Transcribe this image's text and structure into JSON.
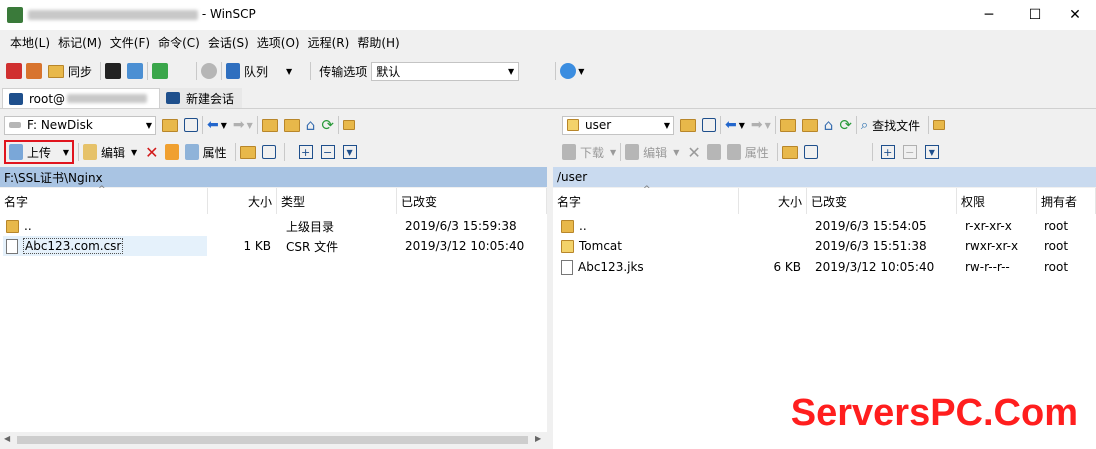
{
  "window": {
    "title_suffix": "- WinSCP",
    "minimize": "─",
    "maximize": "☐",
    "close": "✕"
  },
  "menu": [
    "本地(L)",
    "标记(M)",
    "文件(F)",
    "命令(C)",
    "会话(S)",
    "选项(O)",
    "远程(R)",
    "帮助(H)"
  ],
  "toolbar1": {
    "sync_label": "同步",
    "queue_label": "队列",
    "transfer_label": "传输选项",
    "transfer_value": "默认"
  },
  "tabs": {
    "session_label": "root@",
    "new_session_label": "新建会话"
  },
  "left": {
    "drive": "F: NewDisk",
    "upload_label": "上传",
    "edit_label": "编辑",
    "props_label": "属性",
    "path": "F:\\SSL证书\\Nginx",
    "columns": [
      "名字",
      "大小",
      "类型",
      "已改变"
    ],
    "rows": [
      {
        "name": "..",
        "size": "",
        "type": "上级目录",
        "changed": "2019/6/3  15:59:38"
      },
      {
        "name": "Abc123.com.csr",
        "size": "1 KB",
        "type": "CSR 文件",
        "changed": "2019/3/12  10:05:40"
      }
    ]
  },
  "right": {
    "drive": "user",
    "find_label": "查找文件",
    "download_label": "下载",
    "edit_label": "编辑",
    "props_label": "属性",
    "path": "/user",
    "columns": [
      "名字",
      "大小",
      "已改变",
      "权限",
      "拥有者"
    ],
    "rows": [
      {
        "name": "..",
        "size": "",
        "changed": "2019/6/3  15:54:05",
        "perm": "r-xr-xr-x",
        "owner": "root"
      },
      {
        "name": "Tomcat",
        "size": "",
        "changed": "2019/6/3  15:51:38",
        "perm": "rwxr-xr-x",
        "owner": "root"
      },
      {
        "name": "Abc123.jks",
        "size": "6 KB",
        "changed": "2019/3/12  10:05:40",
        "perm": "rw-r--r--",
        "owner": "root"
      }
    ]
  },
  "watermark": "ServersPC.Com"
}
